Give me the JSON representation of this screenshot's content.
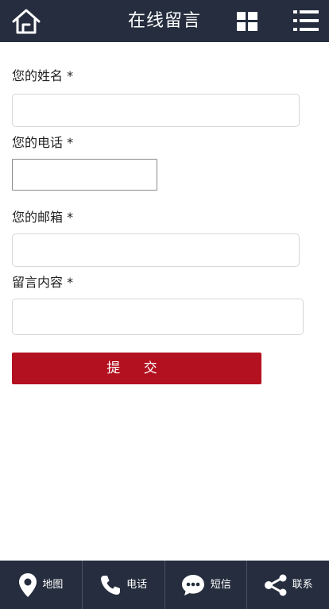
{
  "header": {
    "title": "在线留言",
    "home_icon": "home-icon",
    "grid_icon": "grid-icon",
    "menu_icon": "list-menu-icon"
  },
  "form": {
    "name_label": "您的姓名 *",
    "phone_label": "您的电话 *",
    "email_label": "您的邮箱 *",
    "message_label": "留言内容 *",
    "name_value": "",
    "phone_value": "",
    "email_value": "",
    "message_value": "",
    "submit_label": "提 交"
  },
  "bottom_nav": {
    "items": [
      {
        "label": "地图",
        "icon": "map-pin-icon"
      },
      {
        "label": "电话",
        "icon": "phone-icon"
      },
      {
        "label": "短信",
        "icon": "sms-bubble-icon"
      },
      {
        "label": "联系",
        "icon": "share-icon"
      }
    ]
  },
  "colors": {
    "header_bg": "#252d3e",
    "submit_bg": "#b3111f"
  }
}
